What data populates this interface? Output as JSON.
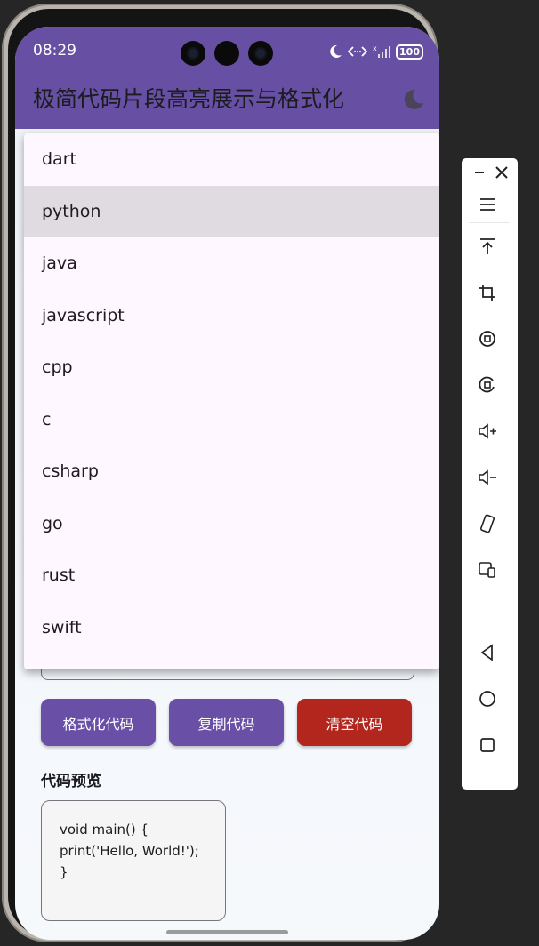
{
  "status": {
    "time": "08:29",
    "battery": "100"
  },
  "app": {
    "title": "极简代码片段高亮展示与格式化"
  },
  "dropdown": {
    "items": [
      "dart",
      "python",
      "java",
      "javascript",
      "cpp",
      "c",
      "csharp",
      "go",
      "rust",
      "swift"
    ],
    "selected": "python"
  },
  "buttons": {
    "format": "格式化代码",
    "copy": "复制代码",
    "clear": "清空代码"
  },
  "preview": {
    "title": "代码预览",
    "lines": [
      "void main() {",
      "print('Hello, World!');",
      "}"
    ]
  },
  "toolbar": {
    "icons": [
      "minimize-icon",
      "close-icon",
      "menu-icon",
      "pin-top-icon",
      "crop-icon",
      "rotate-icon",
      "rotate-alt-icon",
      "volume-up-icon",
      "volume-down-icon",
      "shake-icon",
      "multi-device-icon",
      "back-icon",
      "home-icon",
      "overview-icon"
    ]
  },
  "colors": {
    "primary": "#6750a4",
    "danger": "#b3261e",
    "menu_bg": "#fef7ff",
    "selected_bg": "#e0dbe1"
  }
}
